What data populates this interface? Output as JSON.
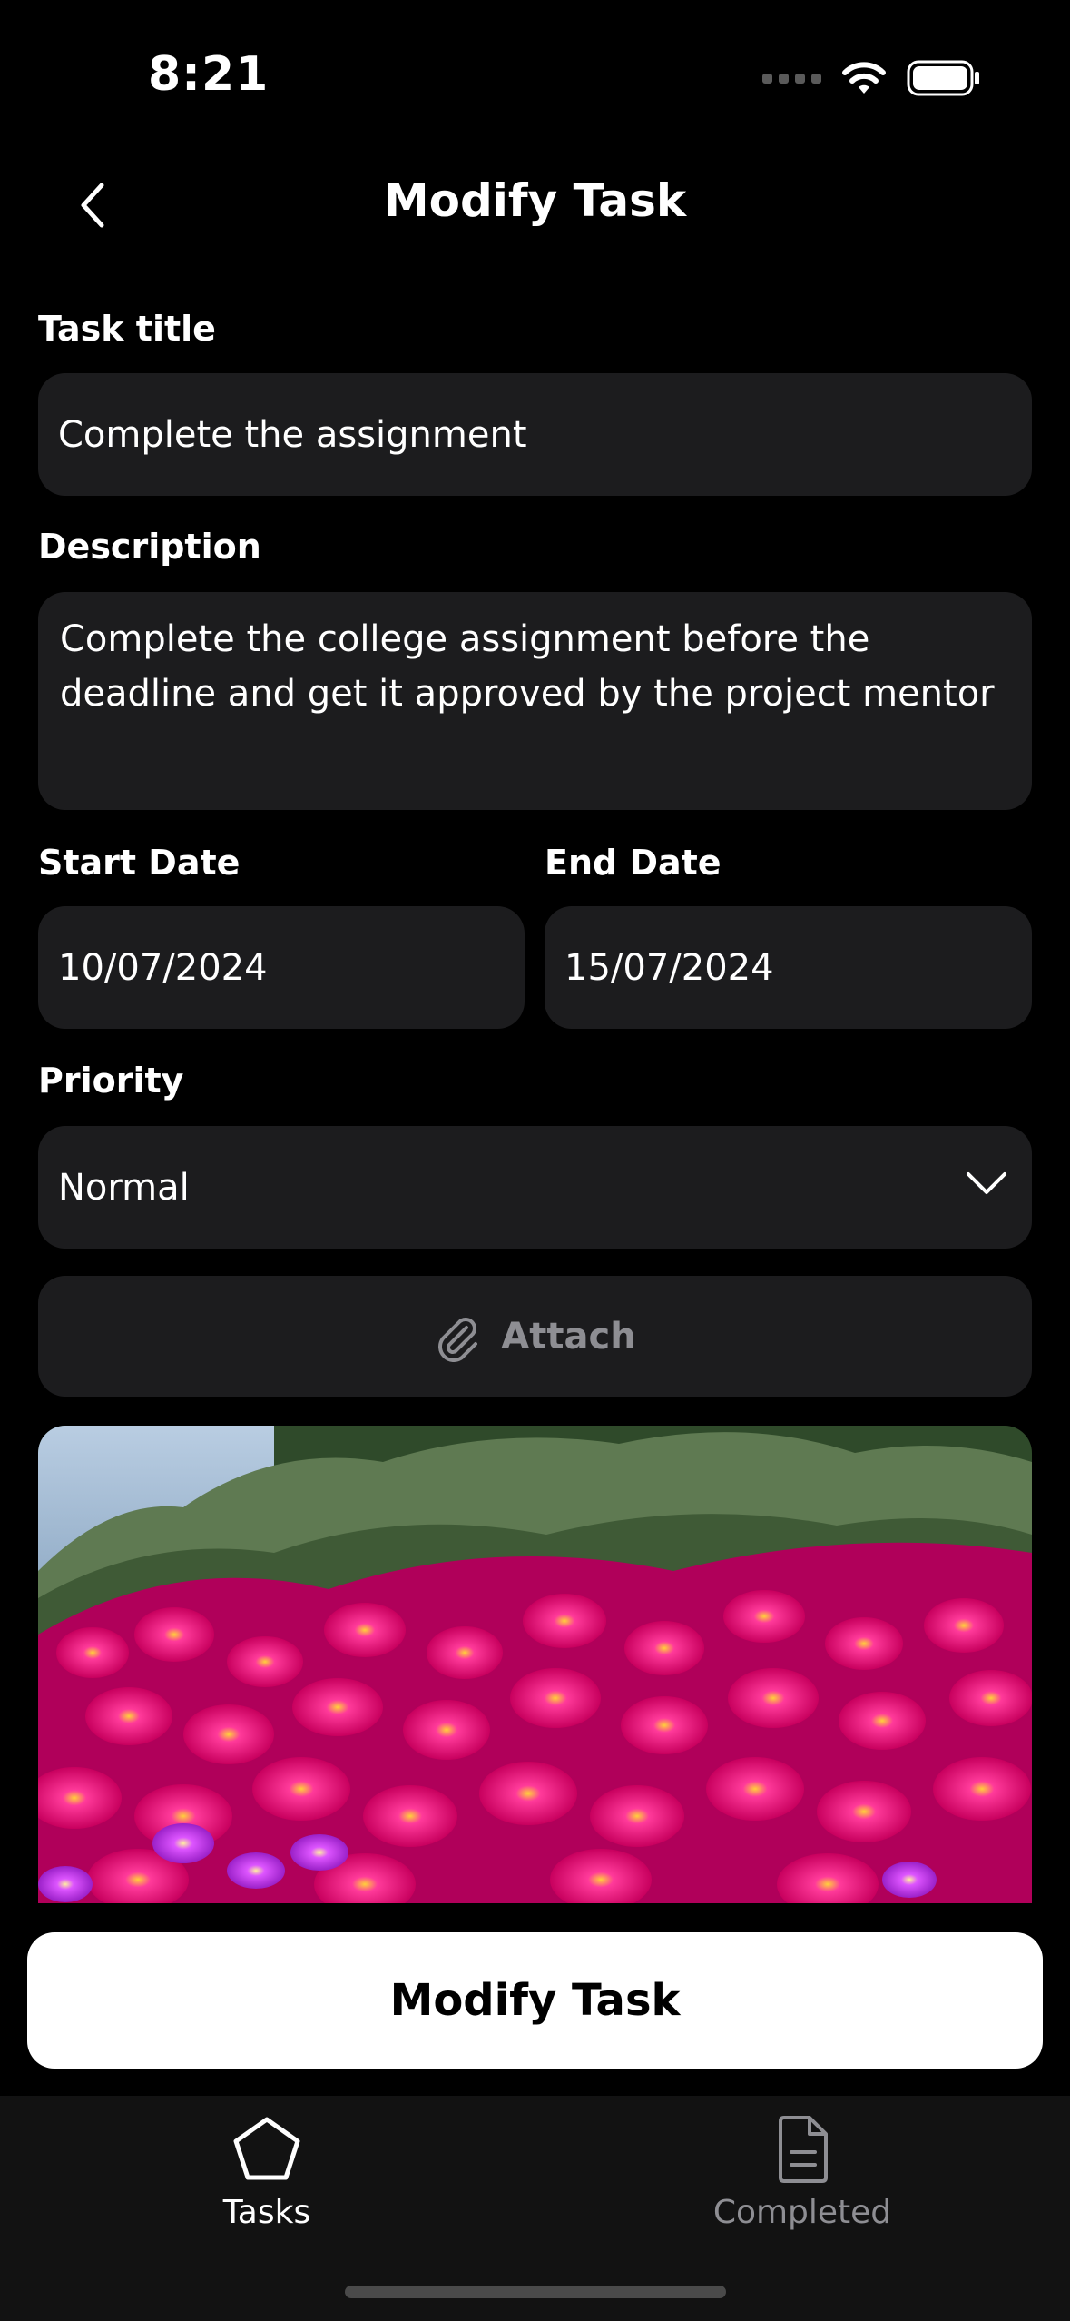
{
  "status_bar": {
    "time": "8:21"
  },
  "header": {
    "title": "Modify Task"
  },
  "form": {
    "title_label": "Task title",
    "title_value": "Complete the assignment",
    "description_label": "Description",
    "description_value": "Complete the college assignment before the deadline and get it approved by the project mentor",
    "start_label": "Start Date",
    "start_value": "10/07/2024",
    "end_label": "End Date",
    "end_value": "15/07/2024",
    "priority_label": "Priority",
    "priority_value": "Normal",
    "attach_label": "Attach"
  },
  "actions": {
    "submit_label": "Modify Task"
  },
  "tabs": [
    {
      "label": "Tasks",
      "icon": "pentagon-icon",
      "active": true
    },
    {
      "label": "Completed",
      "icon": "document-icon",
      "active": false
    }
  ],
  "colors": {
    "background": "#000000",
    "field": "#1c1c1e",
    "muted": "#8e8e93",
    "accent": "#ffffff"
  }
}
